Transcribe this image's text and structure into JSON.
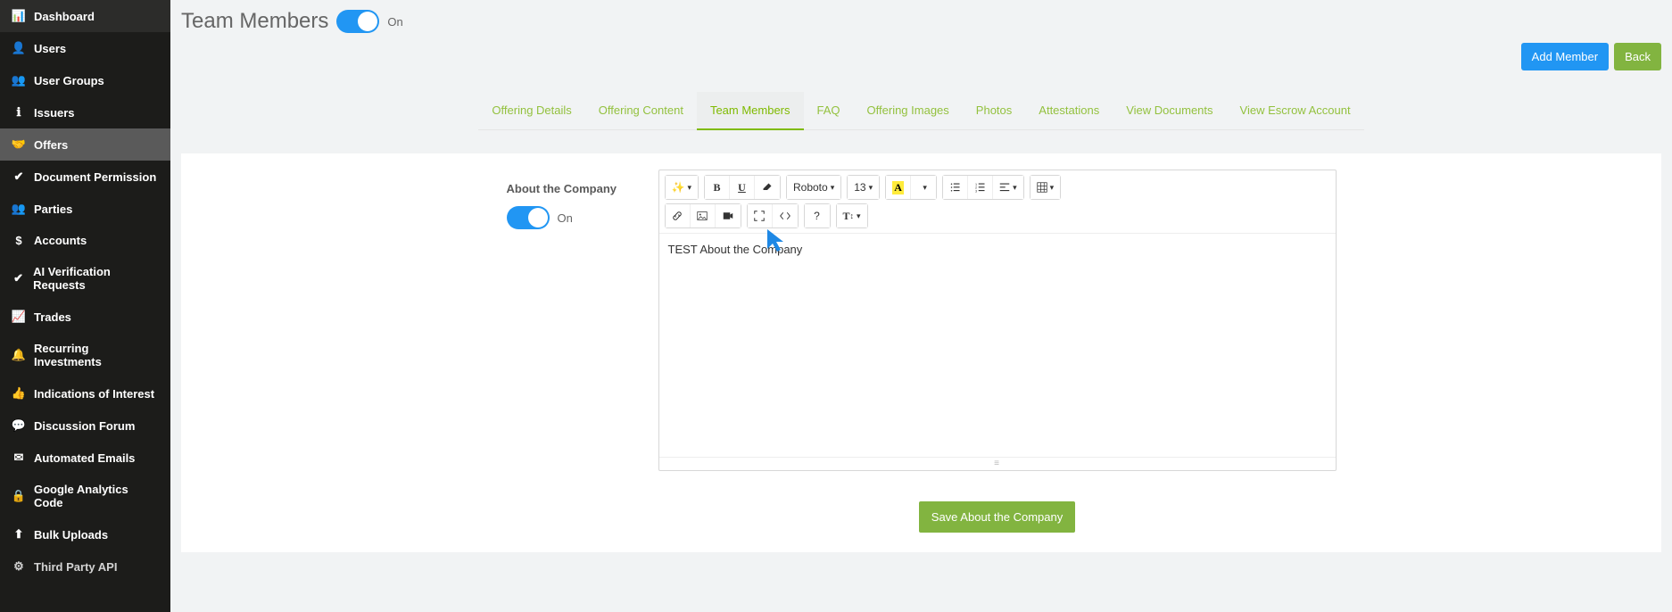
{
  "sidebar": {
    "items": [
      {
        "label": "Dashboard",
        "icon": "dashboard-icon"
      },
      {
        "label": "Users",
        "icon": "user-icon"
      },
      {
        "label": "User Groups",
        "icon": "users-icon"
      },
      {
        "label": "Issuers",
        "icon": "info-icon"
      },
      {
        "label": "Offers",
        "icon": "handshake-icon",
        "active": true
      },
      {
        "label": "Document Permission",
        "icon": "check-icon"
      },
      {
        "label": "Parties",
        "icon": "group-icon"
      },
      {
        "label": "Accounts",
        "icon": "dollar-icon"
      },
      {
        "label": "AI Verification Requests",
        "icon": "check-icon"
      },
      {
        "label": "Trades",
        "icon": "chart-icon"
      },
      {
        "label": "Recurring Investments",
        "icon": "bell-icon"
      },
      {
        "label": "Indications of Interest",
        "icon": "thumb-icon"
      },
      {
        "label": "Discussion Forum",
        "icon": "comment-icon"
      },
      {
        "label": "Automated Emails",
        "icon": "mail-icon"
      },
      {
        "label": "Google Analytics Code",
        "icon": "lock-icon"
      },
      {
        "label": "Bulk Uploads",
        "icon": "upload-icon"
      },
      {
        "label": "Third Party API",
        "icon": "gear-icon"
      }
    ]
  },
  "header": {
    "title": "Team Members",
    "toggle_state": "On"
  },
  "actions": {
    "add_member": "Add Member",
    "back": "Back"
  },
  "tabs": [
    {
      "label": "Offering Details"
    },
    {
      "label": "Offering Content"
    },
    {
      "label": "Team Members",
      "active": true
    },
    {
      "label": "FAQ"
    },
    {
      "label": "Offering Images"
    },
    {
      "label": "Photos"
    },
    {
      "label": "Attestations"
    },
    {
      "label": "View Documents"
    },
    {
      "label": "View Escrow Account"
    }
  ],
  "section": {
    "title": "About the Company",
    "toggle_state": "On",
    "save_label": "Save About the Company"
  },
  "editor": {
    "font_family": "Roboto",
    "font_size": "13",
    "content": "TEST About the Company"
  }
}
